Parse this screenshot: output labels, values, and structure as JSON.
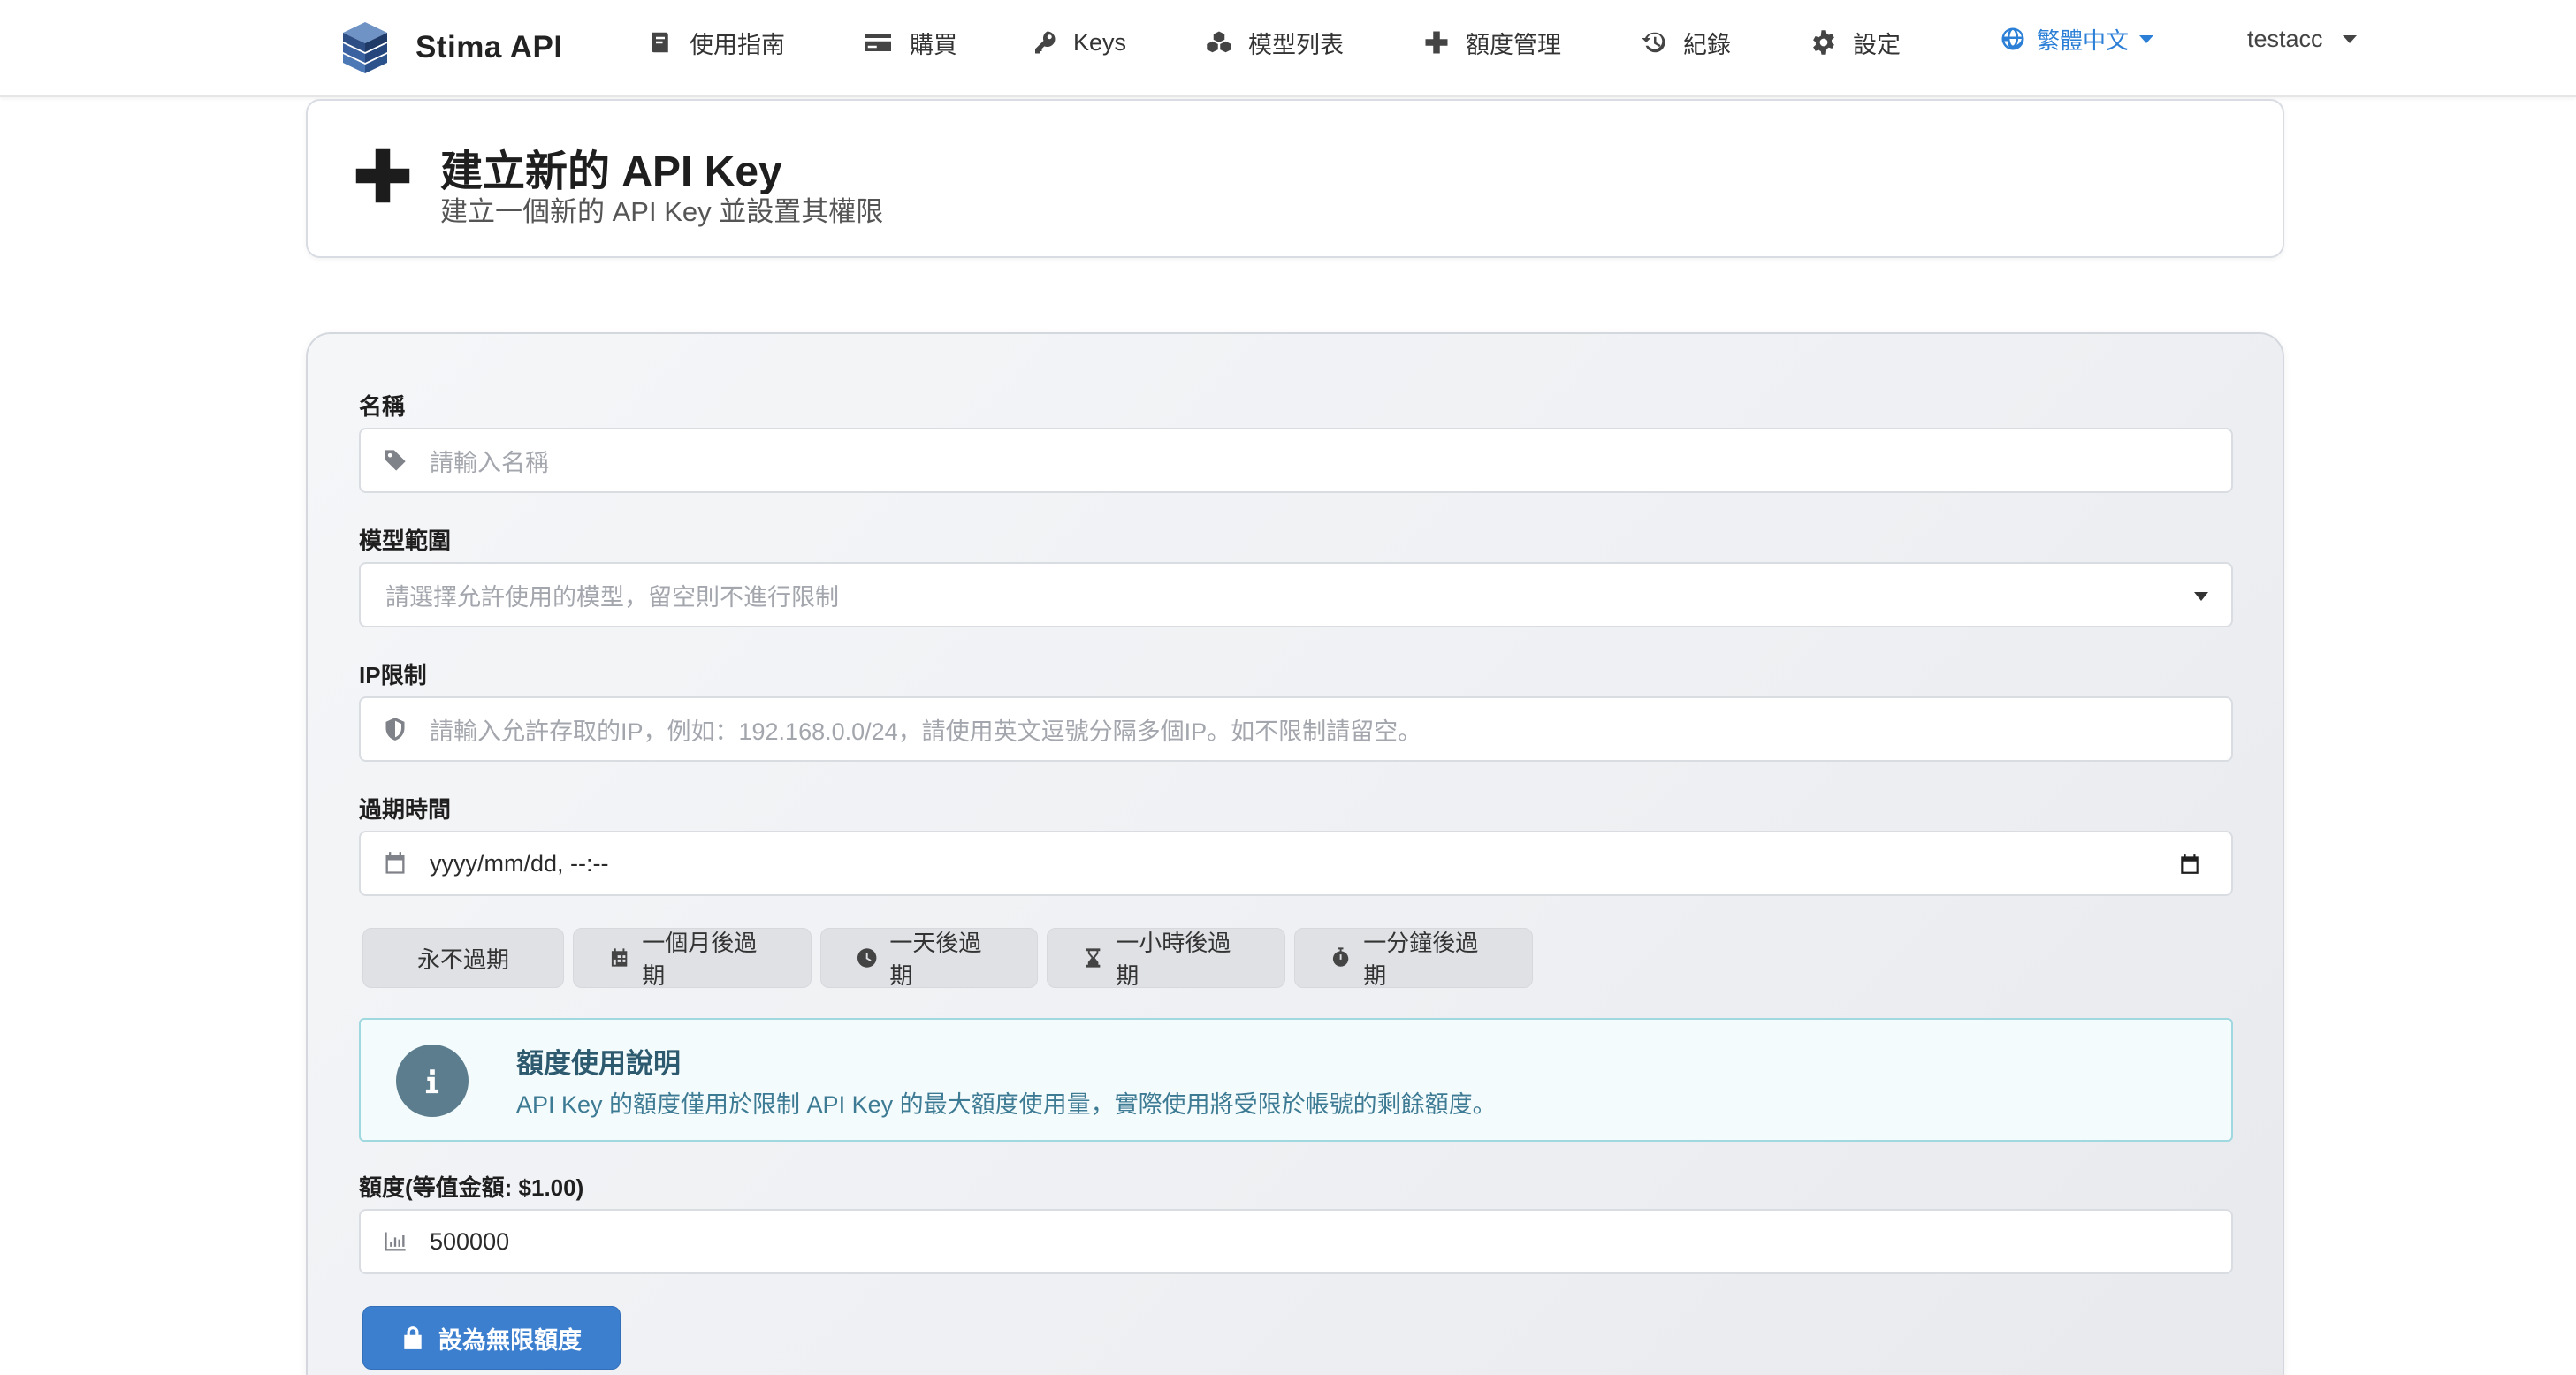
{
  "brand": {
    "name": "Stima API",
    "logo_icon": "stacked-cubes-logo"
  },
  "nav": {
    "items": [
      {
        "label": "使用指南",
        "icon": "book-icon"
      },
      {
        "label": "購買",
        "icon": "credit-card-icon"
      },
      {
        "label": "Keys",
        "icon": "key-icon"
      },
      {
        "label": "模型列表",
        "icon": "cubes-icon"
      },
      {
        "label": "額度管理",
        "icon": "plus-icon"
      },
      {
        "label": "紀錄",
        "icon": "history-icon"
      },
      {
        "label": "設定",
        "icon": "gear-icon"
      }
    ],
    "language": "繁體中文",
    "user": "testacc"
  },
  "header": {
    "title": "建立新的 API Key",
    "subtitle": "建立一個新的 API Key 並設置其權限"
  },
  "form": {
    "name": {
      "label": "名稱",
      "placeholder": "請輸入名稱"
    },
    "model_scope": {
      "label": "模型範圍",
      "placeholder": "請選擇允許使用的模型，留空則不進行限制"
    },
    "ip_limit": {
      "label": "IP限制",
      "placeholder": "請輸入允許存取的IP，例如：192.168.0.0/24，請使用英文逗號分隔多個IP。如不限制請留空。"
    },
    "expiry": {
      "label": "過期時間",
      "value": "yyyy/mm/dd, --:--"
    },
    "quick_buttons": [
      {
        "label": "永不過期",
        "icon": ""
      },
      {
        "label": "一個月後過期",
        "icon": "calendar-icon"
      },
      {
        "label": "一天後過期",
        "icon": "clock-icon"
      },
      {
        "label": "一小時後過期",
        "icon": "hourglass-icon"
      },
      {
        "label": "一分鐘後過期",
        "icon": "stopwatch-icon"
      }
    ],
    "info": {
      "title": "額度使用說明",
      "text": "API Key 的額度僅用於限制 API Key 的最大額度使用量，實際使用將受限於帳號的剩餘額度。"
    },
    "quota": {
      "label": "額度(等值金額: $1.00)",
      "value": "500000"
    },
    "unlimited_button": "設為無限額度"
  },
  "colors": {
    "accent": "#3d7fcf",
    "lang_link": "#2b7fd6",
    "info_border": "#9fd8df",
    "info_title": "#2d5a6e"
  }
}
